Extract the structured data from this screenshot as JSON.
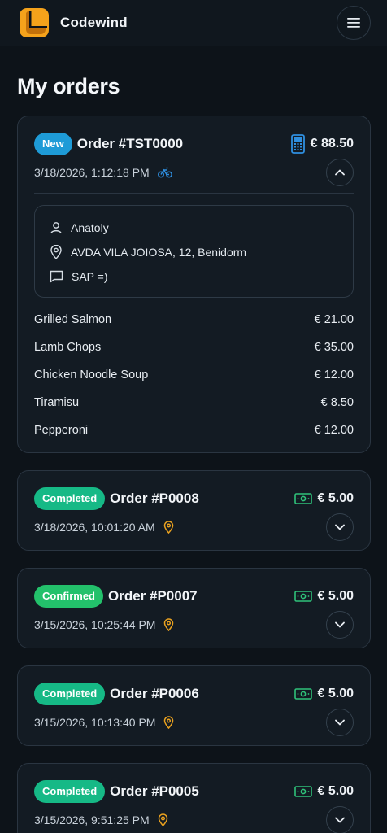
{
  "app": {
    "name": "Codewind"
  },
  "page": {
    "title": "My orders"
  },
  "orders": [
    {
      "status": "New",
      "order_no": "Order #TST0000",
      "price": "€ 88.50",
      "payment_icon": "card-terminal-icon",
      "datetime": "3/18/2026, 1:12:18 PM",
      "delivery_icon": "bicycle-icon",
      "expanded": true,
      "customer": {
        "name": "Anatoly",
        "address": "AVDA VILA JOIOSA, 12, Benidorm",
        "comment": "SAP =)"
      },
      "items": [
        {
          "name": "Grilled Salmon",
          "price": "€ 21.00"
        },
        {
          "name": "Lamb Chops",
          "price": "€ 35.00"
        },
        {
          "name": "Chicken Noodle Soup",
          "price": "€ 12.00"
        },
        {
          "name": "Tiramisu",
          "price": "€ 8.50"
        },
        {
          "name": "Pepperoni",
          "price": "€ 12.00"
        }
      ]
    },
    {
      "status": "Completed",
      "order_no": "Order #P0008",
      "price": "€ 5.00",
      "payment_icon": "cash-icon",
      "datetime": "3/18/2026, 10:01:20 AM",
      "delivery_icon": "location-pin-icon"
    },
    {
      "status": "Confirmed",
      "order_no": "Order #P0007",
      "price": "€ 5.00",
      "payment_icon": "cash-icon",
      "datetime": "3/15/2026, 10:25:44 PM",
      "delivery_icon": "location-pin-icon"
    },
    {
      "status": "Completed",
      "order_no": "Order #P0006",
      "price": "€ 5.00",
      "payment_icon": "cash-icon",
      "datetime": "3/15/2026, 10:13:40 PM",
      "delivery_icon": "location-pin-icon"
    },
    {
      "status": "Completed",
      "order_no": "Order #P0005",
      "price": "€ 5.00",
      "payment_icon": "cash-icon",
      "datetime": "3/15/2026, 9:51:25 PM",
      "delivery_icon": "location-pin-icon"
    }
  ],
  "colors": {
    "accent_orange": "#f5a21b",
    "badge_new": "#1e9bd7",
    "badge_completed": "#16b986",
    "badge_confirmed": "#23c16b",
    "cash_green": "#2fc27a",
    "terminal_blue": "#2f8fe0",
    "pin_orange": "#e9a11f"
  }
}
